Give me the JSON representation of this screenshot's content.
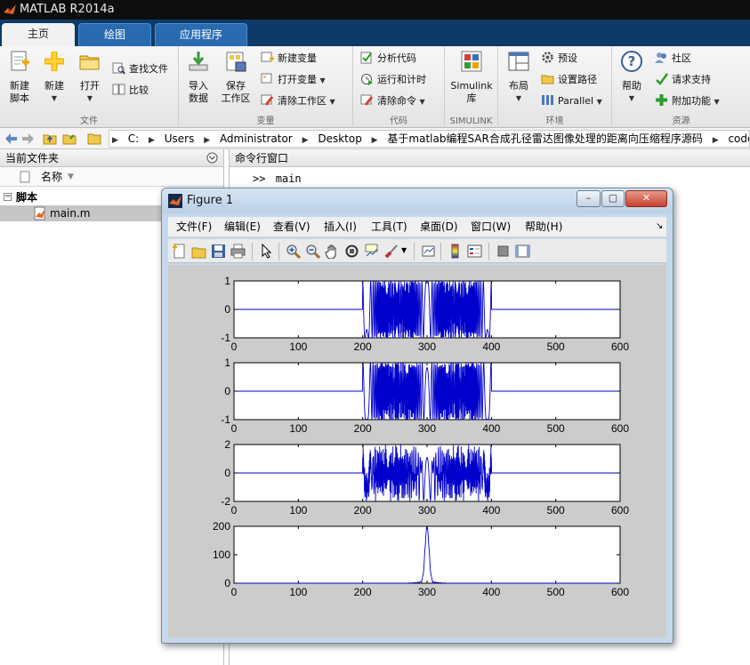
{
  "app": {
    "title": "MATLAB R2014a"
  },
  "ribbon_tabs": [
    "主页",
    "绘图",
    "应用程序"
  ],
  "ribbon": {
    "file_group": {
      "label": "文件",
      "new_script": "新建\n脚本",
      "new": "新建",
      "open": "打开",
      "find_files": "查找文件",
      "compare": "比较"
    },
    "variable_group": {
      "label": "变量",
      "import_data": "导入\n数据",
      "save_workspace": "保存\n工作区",
      "new_variable": "新建变量",
      "open_variable": "打开变量",
      "clear_workspace": "清除工作区"
    },
    "code_group": {
      "label": "代码",
      "analyze_code": "分析代码",
      "run_and_time": "运行和计时",
      "clear_commands": "清除命令"
    },
    "simulink_group": {
      "label": "SIMULINK",
      "simulink_library": "Simulink\n库"
    },
    "environment_group": {
      "label": "环境",
      "layout": "布局",
      "preferences": "预设",
      "set_path": "设置路径",
      "parallel": "Parallel"
    },
    "resources_group": {
      "label": "资源",
      "help": "帮助",
      "community": "社区",
      "request_support": "请求支持",
      "add_ons": "附加功能"
    }
  },
  "address_bar": {
    "path": [
      "C:",
      "Users",
      "Administrator",
      "Desktop",
      "基于matlab编程SAR合成孔径雷达图像处理的距离向压缩程序源码",
      "code"
    ]
  },
  "current_folder": {
    "title": "当前文件夹",
    "name_column": "名称",
    "groups": [
      {
        "label": "脚本",
        "files": [
          "main.m"
        ]
      }
    ]
  },
  "command_window": {
    "title": "命令行窗口",
    "prompt": ">>",
    "command": "main"
  },
  "figure": {
    "title": "Figure 1",
    "menus": [
      "文件(F)",
      "编辑(E)",
      "查看(V)",
      "插入(I)",
      "工具(T)",
      "桌面(D)",
      "窗口(W)",
      "帮助(H)"
    ],
    "toolbar_icons": [
      "new-figure-icon",
      "open-file-icon",
      "save-icon",
      "print-icon",
      "pointer-icon",
      "zoom-in-icon",
      "zoom-out-icon",
      "pan-icon",
      "rotate-icon",
      "data-cursor-icon",
      "brush-icon",
      "link-plot-icon",
      "colorbar-icon",
      "legend-icon",
      "hide-plot-tools-icon",
      "show-plot-tools-icon"
    ]
  },
  "colors": {
    "plot_line": "#0000cc",
    "ribbon_tab_bar": "#0e3a68",
    "figure_bg": "#cccccc"
  },
  "chart_data": [
    {
      "type": "line",
      "description_source": "subplot 1: real part of LFM chirp signal",
      "xlim": [
        0,
        600
      ],
      "ylim": [
        -1,
        1
      ],
      "xticks": [
        "0",
        "100",
        "200",
        "300",
        "400",
        "500",
        "600"
      ],
      "yticks": [
        "1",
        "0",
        "-1"
      ],
      "signal": {
        "kind": "chirp",
        "t0": 200,
        "t1": 400,
        "amplitude": 1,
        "center": 300,
        "rate": 0.0032,
        "phase": 0
      }
    },
    {
      "type": "line",
      "description_source": "subplot 2: matched filter reference (chirp)",
      "xlim": [
        0,
        600
      ],
      "ylim": [
        -1,
        1
      ],
      "xticks": [
        "0",
        "100",
        "200",
        "300",
        "400",
        "500",
        "600"
      ],
      "yticks": [
        "1",
        "0",
        "-1"
      ],
      "signal": {
        "kind": "chirp",
        "t0": 200,
        "t1": 400,
        "amplitude": 1,
        "center": 300,
        "rate": 0.0032,
        "phase": 0.6
      }
    },
    {
      "type": "line",
      "description_source": "subplot 3: superposed signal",
      "xlim": [
        0,
        600
      ],
      "ylim": [
        -2,
        2
      ],
      "xticks": [
        "0",
        "100",
        "200",
        "300",
        "400",
        "500",
        "600"
      ],
      "yticks": [
        "2",
        "0",
        "-2"
      ],
      "signal": {
        "kind": "chirp_sum",
        "t0": 200,
        "t1": 400,
        "amplitude": 1,
        "center": 300,
        "rate": 0.0032,
        "phase": 0.6
      }
    },
    {
      "type": "line",
      "description_source": "subplot 4: compressed pulse magnitude",
      "xlim": [
        0,
        600
      ],
      "ylim": [
        0,
        200
      ],
      "xticks": [
        "0",
        "100",
        "200",
        "300",
        "400",
        "500",
        "600"
      ],
      "yticks": [
        "200",
        "100",
        "0"
      ],
      "signal": {
        "kind": "sinc_peak",
        "t0": 200,
        "t1": 400,
        "peak": 200,
        "center": 300,
        "width": 4
      }
    }
  ]
}
